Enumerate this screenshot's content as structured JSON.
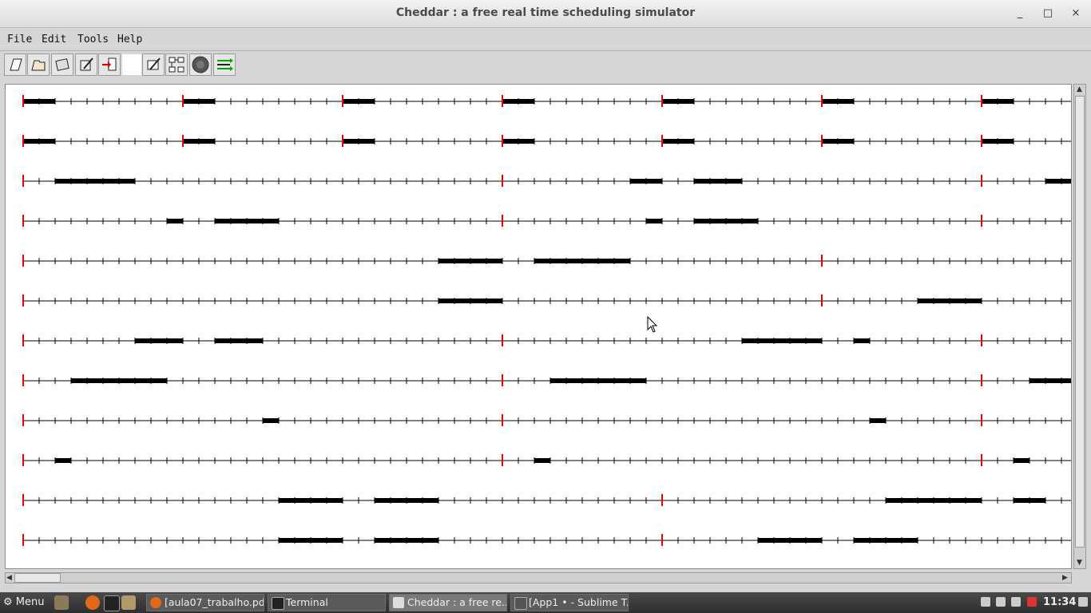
{
  "window": {
    "title": "Cheddar : a free real time scheduling simulator",
    "controls": [
      "_",
      "□",
      "×"
    ]
  },
  "menu": [
    "File",
    "Edit",
    "Tools",
    "Help"
  ],
  "toolbar_icons": [
    "new-file-icon",
    "open-folder-icon",
    "save-icon",
    "edit-icon",
    "import-icon",
    "edit-scheduling-icon",
    "architecture-icon",
    "simulate-icon",
    "schedule-arrows-icon"
  ],
  "timeline": {
    "line_color": "#000000",
    "release_color": "#e00000",
    "rows": [
      {
        "releases": [
          0,
          10,
          20,
          30,
          40,
          50,
          60
        ],
        "segments": [
          [
            0,
            2
          ],
          [
            10,
            12
          ],
          [
            20,
            22
          ],
          [
            30,
            32
          ],
          [
            40,
            42
          ],
          [
            50,
            52
          ],
          [
            60,
            62
          ]
        ]
      },
      {
        "releases": [
          0,
          10,
          20,
          30,
          40,
          50,
          60
        ],
        "segments": [
          [
            0,
            2
          ],
          [
            10,
            12
          ],
          [
            20,
            22
          ],
          [
            30,
            32
          ],
          [
            40,
            42
          ],
          [
            50,
            52
          ],
          [
            60,
            62
          ]
        ]
      },
      {
        "releases": [
          0,
          30,
          60
        ],
        "segments": [
          [
            2,
            7
          ],
          [
            38,
            40
          ],
          [
            42,
            45
          ],
          [
            64,
            66
          ]
        ]
      },
      {
        "releases": [
          0,
          30,
          60
        ],
        "segments": [
          [
            9,
            10
          ],
          [
            12,
            16
          ],
          [
            39,
            40
          ],
          [
            42,
            46
          ]
        ]
      },
      {
        "releases": [
          0,
          50
        ],
        "segments": [
          [
            26,
            30
          ],
          [
            32,
            38
          ]
        ]
      },
      {
        "releases": [
          0,
          50
        ],
        "segments": [
          [
            26,
            30
          ],
          [
            56,
            60
          ]
        ]
      },
      {
        "releases": [
          0,
          30,
          60
        ],
        "segments": [
          [
            7,
            10
          ],
          [
            12,
            15
          ],
          [
            45,
            50
          ],
          [
            52,
            53
          ]
        ]
      },
      {
        "releases": [
          0,
          30,
          60
        ],
        "segments": [
          [
            3,
            9
          ],
          [
            33,
            39
          ],
          [
            63,
            66
          ]
        ]
      },
      {
        "releases": [
          0,
          30,
          60
        ],
        "segments": [
          [
            15,
            16
          ],
          [
            53,
            54
          ]
        ]
      },
      {
        "releases": [
          0,
          30,
          60
        ],
        "segments": [
          [
            2,
            3
          ],
          [
            32,
            33
          ],
          [
            62,
            63
          ]
        ]
      },
      {
        "releases": [
          0,
          40
        ],
        "segments": [
          [
            16,
            20
          ],
          [
            22,
            26
          ],
          [
            54,
            60
          ],
          [
            62,
            64
          ]
        ]
      },
      {
        "releases": [
          0,
          40
        ],
        "segments": [
          [
            16,
            20
          ],
          [
            22,
            26
          ],
          [
            46,
            50
          ],
          [
            52,
            56
          ]
        ]
      }
    ]
  },
  "taskbar": {
    "menu_label": "Menu",
    "tasks": [
      {
        "label": "[aula07_trabalho.pd..."
      },
      {
        "label": "Terminal"
      },
      {
        "label": "Cheddar : a free re...",
        "active": true
      },
      {
        "label": "[App1 • - Sublime T..."
      }
    ],
    "clock": "11:34"
  }
}
